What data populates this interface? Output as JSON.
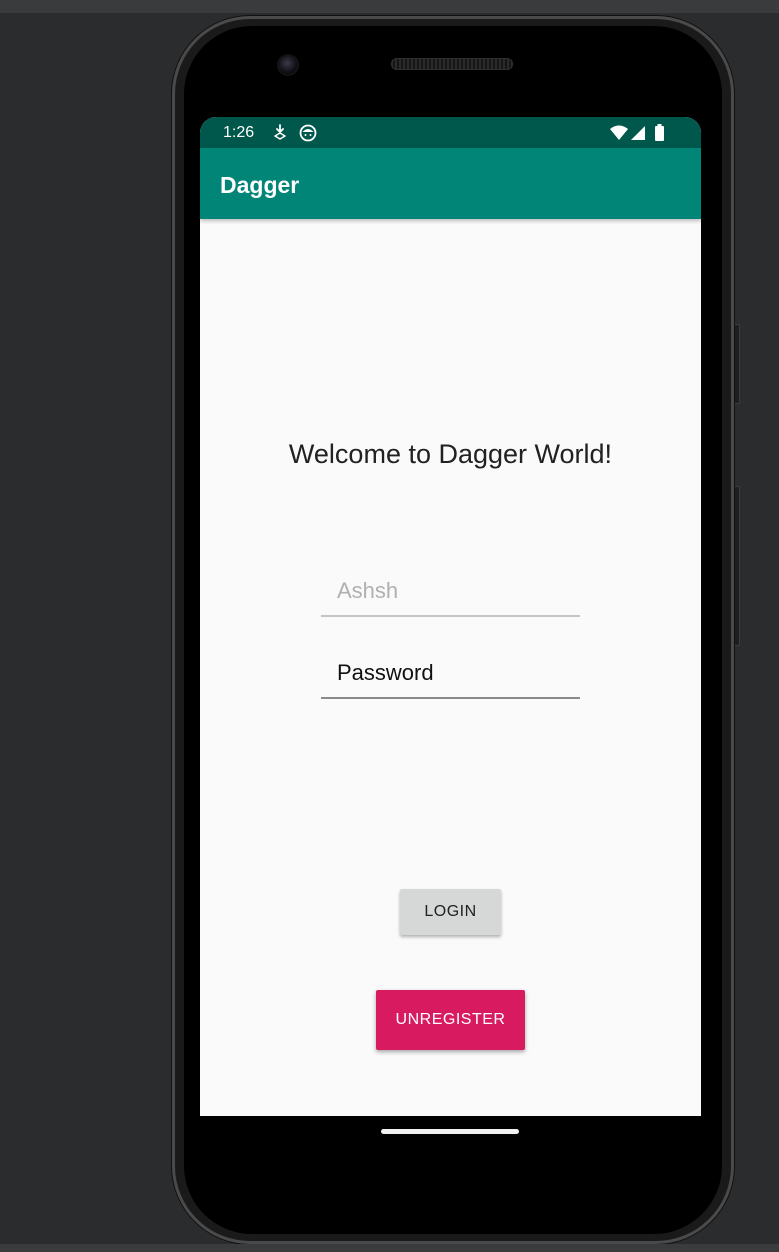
{
  "status_bar": {
    "time": "1:26",
    "left_icons": [
      "download-notification-icon",
      "android-notification-icon"
    ],
    "right_icons": [
      "wifi-icon",
      "cell-signal-icon",
      "battery-icon"
    ],
    "background_color": "#00574b"
  },
  "app_bar": {
    "title": "Dagger",
    "background_color": "#008577"
  },
  "main": {
    "welcome_text": "Welcome to Dagger World!",
    "username_field": {
      "placeholder": "Ashsh",
      "value": ""
    },
    "password_field": {
      "placeholder": "Password",
      "value": ""
    },
    "login_button_label": "LOGIN",
    "unregister_button_label": "UNREGISTER"
  },
  "colors": {
    "accent": "#d81b60",
    "primary": "#008577",
    "primary_dark": "#00574b"
  }
}
